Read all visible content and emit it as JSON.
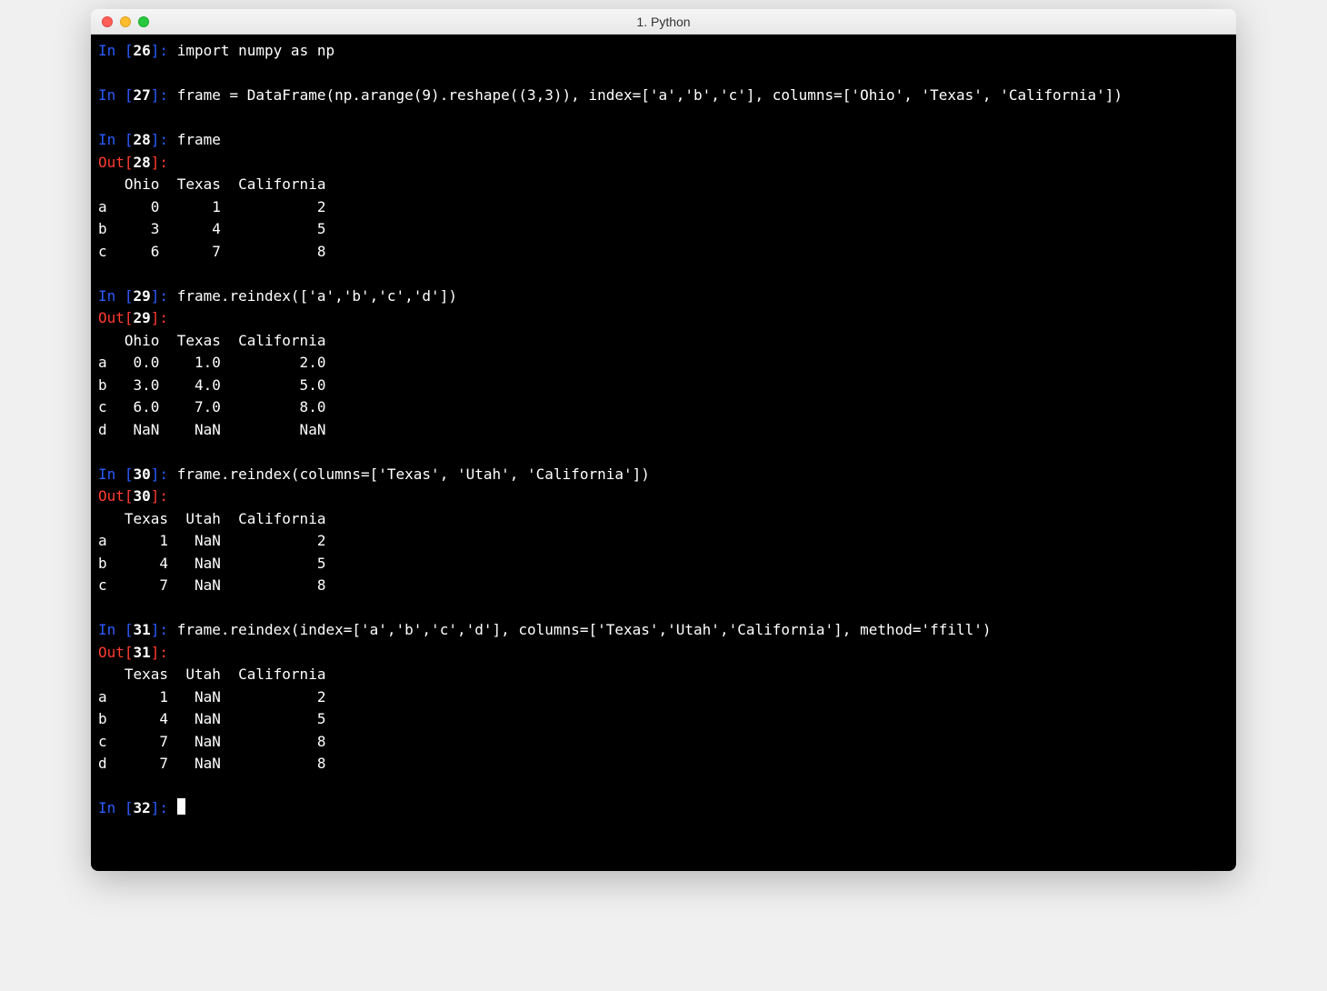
{
  "window": {
    "title": "1. Python"
  },
  "cells": [
    {
      "n": "26",
      "in": "import numpy as np",
      "out_label": false,
      "out": ""
    },
    {
      "n": "27",
      "in": "frame = DataFrame(np.arange(9).reshape((3,3)), index=['a','b','c'], columns=['Ohio', 'Texas', 'California'])",
      "out_label": false,
      "out": ""
    },
    {
      "n": "28",
      "in": "frame",
      "out_label": true,
      "out": "   Ohio  Texas  California\na     0      1           2\nb     3      4           5\nc     6      7           8"
    },
    {
      "n": "29",
      "in": "frame.reindex(['a','b','c','d'])",
      "out_label": true,
      "out": "   Ohio  Texas  California\na   0.0    1.0         2.0\nb   3.0    4.0         5.0\nc   6.0    7.0         8.0\nd   NaN    NaN         NaN"
    },
    {
      "n": "30",
      "in": "frame.reindex(columns=['Texas', 'Utah', 'California'])",
      "out_label": true,
      "out": "   Texas  Utah  California\na      1   NaN           2\nb      4   NaN           5\nc      7   NaN           8"
    },
    {
      "n": "31",
      "in": "frame.reindex(index=['a','b','c','d'], columns=['Texas','Utah','California'], method='ffill')",
      "out_label": true,
      "out": "   Texas  Utah  California\na      1   NaN           2\nb      4   NaN           5\nc      7   NaN           8\nd      7   NaN           8"
    }
  ],
  "next_prompt": "32"
}
